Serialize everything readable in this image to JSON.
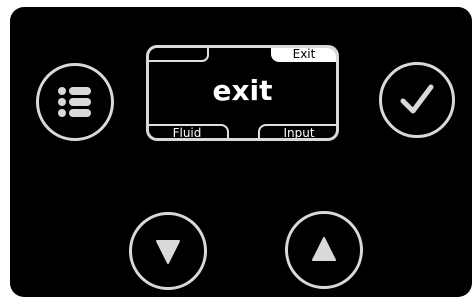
{
  "screen": {
    "main_text": "exit",
    "top_right_tab": "Exit",
    "bottom_left_tab": "Fluid",
    "bottom_right_tab": "Input"
  },
  "icons": {
    "menu": "list-icon",
    "confirm": "checkmark-icon",
    "down": "triangle-down-icon",
    "up": "triangle-up-icon"
  },
  "colors": {
    "panel": "#000000",
    "ring": "#d9d9d9",
    "display_text": "#ffffff"
  }
}
